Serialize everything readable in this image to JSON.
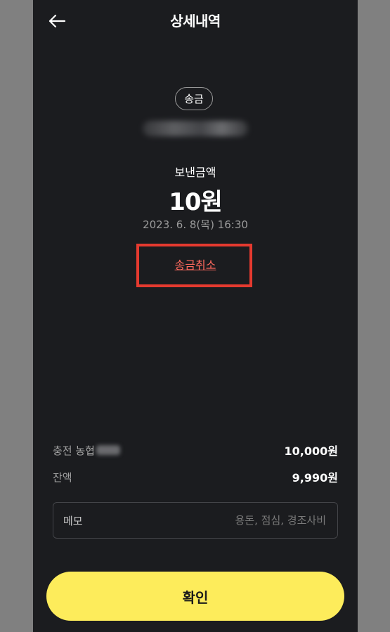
{
  "header": {
    "title": "상세내역",
    "back_icon": "arrow-left-icon"
  },
  "transaction": {
    "type_chip": "송금",
    "amount_label": "보낸금액",
    "amount": "10원",
    "datetime": "2023. 6. 8(목) 16:30",
    "cancel_label": "송금취소"
  },
  "details": {
    "charge": {
      "label": "충전 농협",
      "value": "10,000원"
    },
    "balance": {
      "label": "잔액",
      "value": "9,990원"
    }
  },
  "memo": {
    "label": "메모",
    "placeholder": "용돈, 점심, 경조사비"
  },
  "confirm_label": "확인",
  "colors": {
    "background": "#1b1c1f",
    "accent_yellow": "#fdec5b",
    "cancel_link": "#ff6a5e",
    "highlight_box": "#e53a2f"
  }
}
